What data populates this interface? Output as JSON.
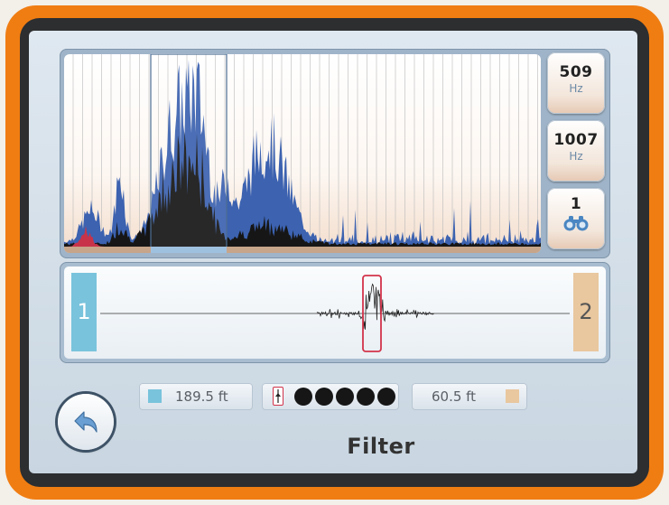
{
  "side_buttons": [
    {
      "value": "509",
      "unit": "Hz"
    },
    {
      "value": "1007",
      "unit": "Hz"
    },
    {
      "value": "1",
      "icon": "binoculars-icon"
    }
  ],
  "waveform": {
    "marker_left": "1",
    "marker_right": "2"
  },
  "distances": {
    "left": "189.5 ft",
    "right": "60.5 ft"
  },
  "mode_title": "Filter",
  "colors": {
    "marker_left": "#79c3dc",
    "marker_right": "#e9c79f",
    "accent": "#f07d12",
    "selection": "#d2334a",
    "spectrum": "#3c62b0"
  },
  "icons": {
    "back": "back-arrow-icon",
    "binoculars": "binoculars-icon"
  }
}
